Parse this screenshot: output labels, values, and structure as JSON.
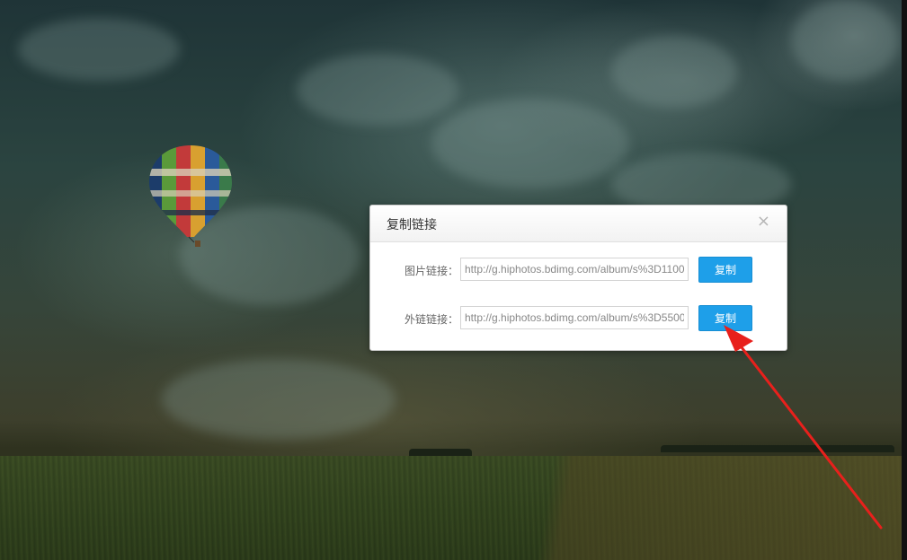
{
  "dialog": {
    "title": "复制链接",
    "close_icon": "×",
    "rows": [
      {
        "label": "图片链接：",
        "value": "http://g.hiphotos.bdimg.com/album/s%3D1100",
        "button": "复制"
      },
      {
        "label": "外链链接：",
        "value": "http://g.hiphotos.bdimg.com/album/s%3D5500",
        "button": "复制"
      }
    ]
  },
  "colors": {
    "button_bg": "#1e9fe9",
    "annotation_arrow": "#e8201c"
  },
  "icons": {
    "close": "close-icon",
    "annotation": "red-arrow-annotation"
  }
}
